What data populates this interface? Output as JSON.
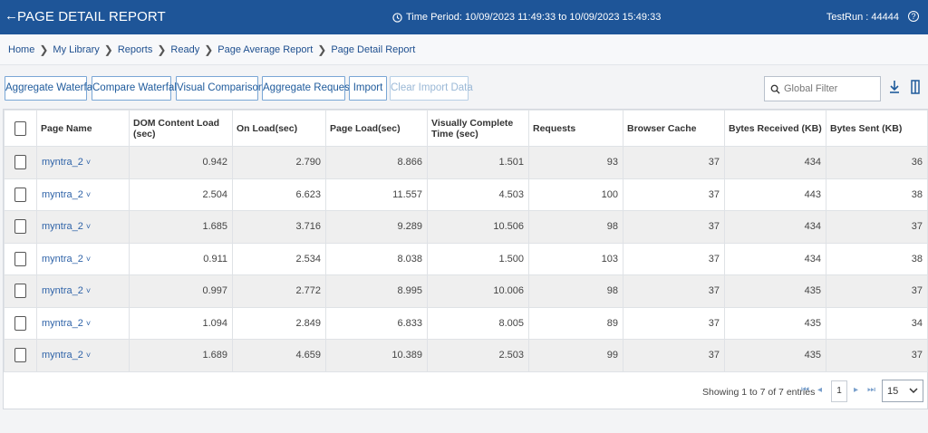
{
  "header": {
    "title": "PAGE DETAIL REPORT",
    "time_period": "Time Period: 10/09/2023 11:49:33 to 10/09/2023 15:49:33",
    "testrun": "TestRun : 44444"
  },
  "breadcrumb": [
    "Home",
    "My Library",
    "Reports",
    "Ready",
    "Page Average Report",
    "Page Detail Report"
  ],
  "toolbar": {
    "buttons": [
      "Aggregate Waterfall",
      "Compare Waterfall",
      "Visual Comparison",
      "Aggregate Request",
      "Import",
      "Clear Import Data"
    ],
    "filter_placeholder": "Global Filter"
  },
  "table": {
    "columns": [
      "Page Name",
      "DOM Content Load (sec)",
      "On Load(sec)",
      "Page Load(sec)",
      "Visually Complete Time (sec)",
      "Requests",
      "Browser Cache",
      "Bytes Received (KB)",
      "Bytes Sent (KB)"
    ],
    "rows": [
      [
        "myntra_2",
        "0.942",
        "2.790",
        "8.866",
        "1.501",
        "93",
        "37",
        "434",
        "36"
      ],
      [
        "myntra_2",
        "2.504",
        "6.623",
        "11.557",
        "4.503",
        "100",
        "37",
        "443",
        "38"
      ],
      [
        "myntra_2",
        "1.685",
        "3.716",
        "9.289",
        "10.506",
        "98",
        "37",
        "434",
        "37"
      ],
      [
        "myntra_2",
        "0.911",
        "2.534",
        "8.038",
        "1.500",
        "103",
        "37",
        "434",
        "38"
      ],
      [
        "myntra_2",
        "0.997",
        "2.772",
        "8.995",
        "10.006",
        "98",
        "37",
        "435",
        "37"
      ],
      [
        "myntra_2",
        "1.094",
        "2.849",
        "6.833",
        "8.005",
        "89",
        "37",
        "435",
        "34"
      ],
      [
        "myntra_2",
        "1.689",
        "4.659",
        "10.389",
        "2.503",
        "99",
        "37",
        "435",
        "37"
      ]
    ]
  },
  "pager": {
    "info": "Showing 1 to 7 of 7 entries",
    "current_page": "1",
    "page_size": "15"
  }
}
